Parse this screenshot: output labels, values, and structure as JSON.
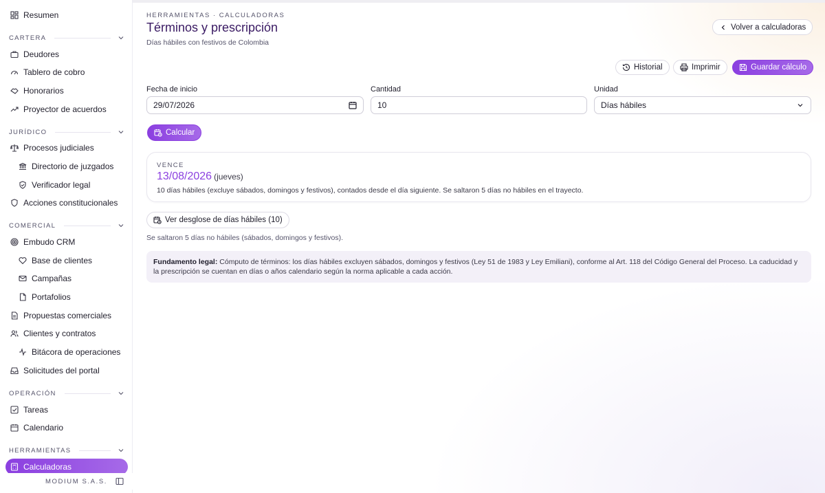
{
  "sidebar": {
    "summary": "Resumen",
    "sections": [
      {
        "title": "CARTERA",
        "items": [
          "Deudores",
          "Tablero de cobro",
          "Honorarios",
          "Proyector de acuerdos"
        ]
      },
      {
        "title": "JURÍDICO",
        "items": [
          "Procesos judiciales",
          "Directorio de juzgados",
          "Verificador legal",
          "Acciones constitucionales"
        ]
      },
      {
        "title": "COMERCIAL",
        "items": [
          "Embudo CRM",
          "Base de clientes",
          "Campañas",
          "Portafolios",
          "Propuestas comerciales",
          "Clientes y contratos",
          "Bitácora de operaciones",
          "Solicitudes del portal"
        ]
      },
      {
        "title": "OPERACIÓN",
        "items": [
          "Tareas",
          "Calendario"
        ]
      },
      {
        "title": "HERRAMIENTAS",
        "items": [
          "Calculadoras"
        ]
      }
    ],
    "active": "Calculadoras",
    "footer": "MODIUM S.A.S."
  },
  "header": {
    "eyebrow": "HERRAMIENTAS · CALCULADORAS",
    "title": "Términos y prescripción",
    "subtitle": "Días hábiles con festivos de Colombia",
    "back_label": "Volver a calculadoras"
  },
  "toolbar": {
    "history_label": "Historial",
    "print_label": "Imprimir",
    "save_label": "Guardar cálculo"
  },
  "form": {
    "start_label": "Fecha de inicio",
    "start_value": "29/07/2026",
    "qty_label": "Cantidad",
    "qty_value": "10",
    "unit_label": "Unidad",
    "unit_value": "Días hábiles",
    "calc_label": "Calcular"
  },
  "result": {
    "label": "VENCE",
    "date": "13/08/2026",
    "day": "(jueves)",
    "description": "10 días hábiles (excluye sábados, domingos y festivos), contados desde el día siguiente. Se saltaron 5 días no hábiles en el trayecto."
  },
  "breakdown": {
    "button_label": "Ver desglose de días hábiles (10)",
    "note": "Se saltaron 5 días no hábiles (sábados, domingos y festivos)."
  },
  "legal": {
    "heading": "Fundamento legal:",
    "text": "Cómputo de términos: los días hábiles excluyen sábados, domingos y festivos (Ley 51 de 1983 y Ley Emiliani), conforme al Art. 118 del Código General del Proceso. La caducidad y la prescripción se cuentan en días o años calendario según la norma aplicable a cada acción."
  },
  "colors": {
    "accent": "#8b3fe0",
    "title": "#3a1a63"
  }
}
